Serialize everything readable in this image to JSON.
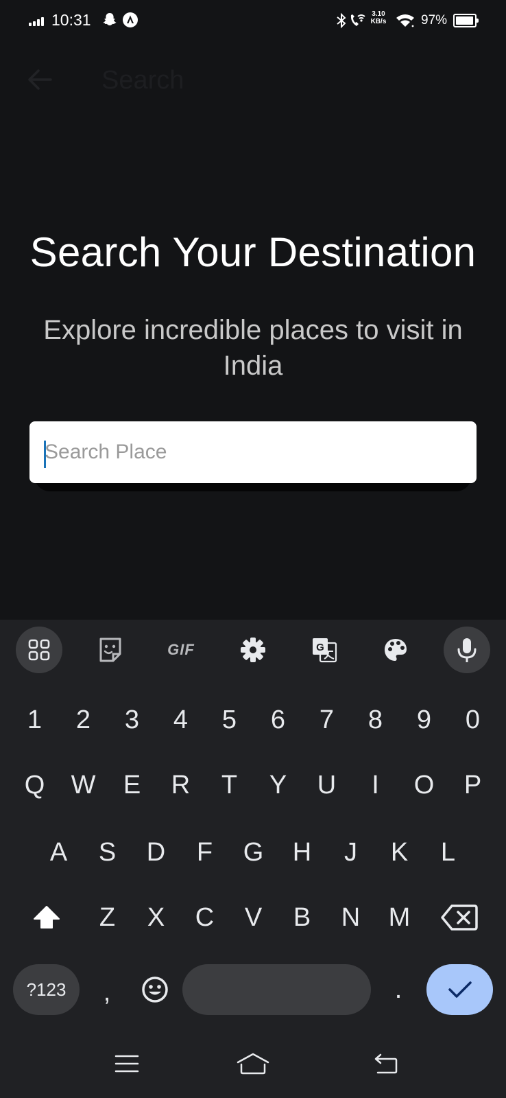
{
  "status_bar": {
    "time": "10:31",
    "net_speed_value": "3.10",
    "net_speed_unit": "KB/s",
    "battery_percent": "97%",
    "battery_level": 0.97,
    "icons": [
      "signal-icon",
      "snapchat-icon",
      "notification-a-icon",
      "bluetooth-icon",
      "wifi-calling-icon",
      "wifi-icon",
      "battery-icon"
    ]
  },
  "app_bar": {
    "title": "Search",
    "back_icon": "arrow-left-icon"
  },
  "hero": {
    "title": "Search Your Destination",
    "subtitle": "Explore incredible places to visit in India"
  },
  "search": {
    "placeholder": "Search Place",
    "value": ""
  },
  "keyboard": {
    "toolbar": {
      "apps_icon": "grid-icon",
      "sticker_icon": "sticker-icon",
      "gif_label": "GIF",
      "settings_icon": "gear-icon",
      "translate_icon": "translate-icon",
      "theme_icon": "palette-icon",
      "mic_icon": "microphone-icon"
    },
    "number_row": [
      "1",
      "2",
      "3",
      "4",
      "5",
      "6",
      "7",
      "8",
      "9",
      "0"
    ],
    "row1": [
      "Q",
      "W",
      "E",
      "R",
      "T",
      "Y",
      "U",
      "I",
      "O",
      "P"
    ],
    "row2": [
      "A",
      "S",
      "D",
      "F",
      "G",
      "H",
      "J",
      "K",
      "L"
    ],
    "row3": [
      "Z",
      "X",
      "C",
      "V",
      "B",
      "N",
      "M"
    ],
    "symbols_label": "?123",
    "comma": ",",
    "period": ".",
    "shift_icon": "shift-icon",
    "backspace_icon": "backspace-icon",
    "emoji_icon": "emoji-icon",
    "done_icon": "checkmark-icon",
    "accent_color": "#a8c7fa"
  },
  "nav_bar": {
    "icons": [
      "menu-icon",
      "home-icon",
      "back-icon"
    ]
  },
  "colors": {
    "background": "#131416",
    "keyboard_bg": "#202124",
    "key_bg": "#3c3d40",
    "caret": "#1a73b8"
  }
}
